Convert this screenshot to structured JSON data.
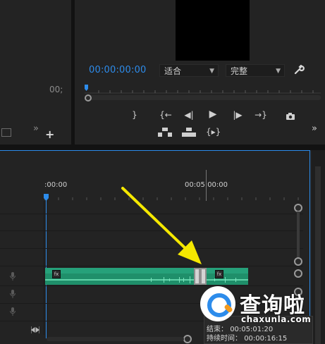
{
  "source_monitor": {
    "timecode_right": "00;",
    "icon_settings": "settings-icon",
    "icon_add": "plus-icon",
    "chevron": "»"
  },
  "program_monitor": {
    "timecode": "00:00:00:00",
    "fit_select": "适合",
    "quality_select": "完整",
    "wrench_icon": "wrench-icon",
    "chevron": "»"
  },
  "transport": {
    "row1": [
      "}",
      "{←",
      "◀|",
      "▶",
      "|▶",
      "→}",
      "camera-icon"
    ],
    "row2": [
      "lift-icon",
      "extract-icon",
      "{▸}"
    ]
  },
  "timeline": {
    "ruler_start": ":00:00",
    "ruler_mid": "00:05:00:00",
    "icon_marker": "marker-icon"
  },
  "watermark": {
    "brand": "查询啦",
    "url": "chaxunla.com"
  },
  "tooltip": {
    "end_label": "结束：",
    "end_value": "00:05:01:20",
    "duration_label": "持续时间：",
    "duration_value": "00:00:16:15"
  },
  "colors": {
    "accent": "#2d8ceb",
    "clip": "#1f8f6a",
    "arrow": "#f5e800",
    "logo_orange": "#f39a1e"
  }
}
